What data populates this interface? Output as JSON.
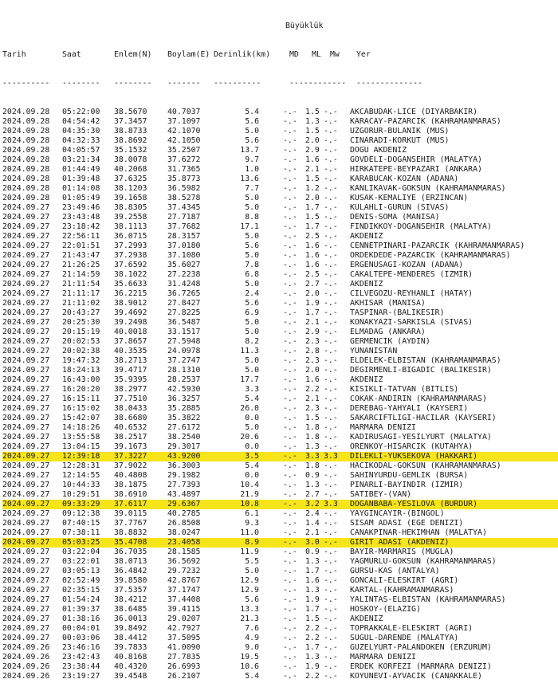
{
  "header": {
    "group_label": "Büyüklük",
    "columns": {
      "date": "Tarih",
      "time": "Saat",
      "lat": "Enlem(N)",
      "lon": "Boylam(E)",
      "depth": "Derinlik(km)",
      "md": "MD",
      "ml": "ML",
      "mw": "Mw",
      "location": "Yer"
    },
    "separators": {
      "date": "----------",
      "time": "--------",
      "lat": "--------",
      "lon": "-------",
      "depth": "----------",
      "mag": "------------",
      "location": "--------------"
    }
  },
  "highlight_color": "#f7e51b",
  "rows": [
    {
      "date": "2024.09.28",
      "time": "05:22:00",
      "lat": "38.5670",
      "lon": "40.7037",
      "depth": "5.4",
      "md": "-.-",
      "ml": "1.5",
      "mw": "-.-",
      "location": "AKCABUDAK-LICE (DIYARBAKIR)",
      "highlight": false
    },
    {
      "date": "2024.09.28",
      "time": "04:54:42",
      "lat": "37.3457",
      "lon": "37.1097",
      "depth": "5.6",
      "md": "-.-",
      "ml": "1.3",
      "mw": "-.-",
      "location": "KARACAY-PAZARCIK (KAHRAMANMARAS)",
      "highlight": false
    },
    {
      "date": "2024.09.28",
      "time": "04:35:30",
      "lat": "38.8733",
      "lon": "42.1070",
      "depth": "5.0",
      "md": "-.-",
      "ml": "1.5",
      "mw": "-.-",
      "location": "UZGORUR-BULANIK (MUS)",
      "highlight": false
    },
    {
      "date": "2024.09.28",
      "time": "04:32:33",
      "lat": "38.8692",
      "lon": "42.1050",
      "depth": "5.6",
      "md": "-.-",
      "ml": "2.0",
      "mw": "-.-",
      "location": "CINARADI-KORKUT (MUS)",
      "highlight": false
    },
    {
      "date": "2024.09.28",
      "time": "04:05:57",
      "lat": "35.1532",
      "lon": "35.2507",
      "depth": "13.7",
      "md": "-.-",
      "ml": "2.9",
      "mw": "-.-",
      "location": "DOGU AKDENIZ",
      "highlight": false
    },
    {
      "date": "2024.09.28",
      "time": "03:21:34",
      "lat": "38.0078",
      "lon": "37.6272",
      "depth": "9.7",
      "md": "-.-",
      "ml": "1.6",
      "mw": "-.-",
      "location": "GOVDELI-DOGANSEHIR (MALATYA)",
      "highlight": false
    },
    {
      "date": "2024.09.28",
      "time": "01:44:49",
      "lat": "40.2068",
      "lon": "31.7365",
      "depth": "1.0",
      "md": "-.-",
      "ml": "2.1",
      "mw": "-.-",
      "location": "HIRKATEPE-BEYPAZARI (ANKARA)",
      "highlight": false
    },
    {
      "date": "2024.09.28",
      "time": "01:39:48",
      "lat": "37.6325",
      "lon": "35.8773",
      "depth": "13.6",
      "md": "-.-",
      "ml": "1.5",
      "mw": "-.-",
      "location": "KARABUCAK-KOZAN (ADANA)",
      "highlight": false
    },
    {
      "date": "2024.09.28",
      "time": "01:14:08",
      "lat": "38.1203",
      "lon": "36.5982",
      "depth": "7.7",
      "md": "-.-",
      "ml": "1.2",
      "mw": "-.-",
      "location": "KANLIKAVAK-GOKSUN (KAHRAMANMARAS)",
      "highlight": false
    },
    {
      "date": "2024.09.28",
      "time": "01:05:49",
      "lat": "39.1658",
      "lon": "38.5278",
      "depth": "5.0",
      "md": "-.-",
      "ml": "2.0",
      "mw": "-.-",
      "location": "KUSAK-KEMALIYE (ERZINCAN)",
      "highlight": false
    },
    {
      "date": "2024.09.27",
      "time": "23:49:46",
      "lat": "38.8305",
      "lon": "37.4345",
      "depth": "5.0",
      "md": "-.-",
      "ml": "1.7",
      "mw": "-.-",
      "location": "KULAHLI-GURUN (SIVAS)",
      "highlight": false
    },
    {
      "date": "2024.09.27",
      "time": "23:43:48",
      "lat": "39.2558",
      "lon": "27.7187",
      "depth": "8.8",
      "md": "-.-",
      "ml": "1.5",
      "mw": "-.-",
      "location": "DENIS-SOMA (MANISA)",
      "highlight": false
    },
    {
      "date": "2024.09.27",
      "time": "23:18:42",
      "lat": "38.1113",
      "lon": "37.7682",
      "depth": "17.1",
      "md": "-.-",
      "ml": "1.7",
      "mw": "-.-",
      "location": "FINDIKKOY-DOGANSEHIR (MALATYA)",
      "highlight": false
    },
    {
      "date": "2024.09.27",
      "time": "22:56:11",
      "lat": "36.0715",
      "lon": "28.3157",
      "depth": "5.0",
      "md": "-.-",
      "ml": "2.5",
      "mw": "-.-",
      "location": "AKDENIZ",
      "highlight": false
    },
    {
      "date": "2024.09.27",
      "time": "22:01:51",
      "lat": "37.2993",
      "lon": "37.0180",
      "depth": "5.6",
      "md": "-.-",
      "ml": "1.6",
      "mw": "-.-",
      "location": "CENNETPINARI-PAZARCIK (KAHRAMANMARAS)",
      "highlight": false
    },
    {
      "date": "2024.09.27",
      "time": "21:43:47",
      "lat": "37.2938",
      "lon": "37.1080",
      "depth": "5.0",
      "md": "-.-",
      "ml": "1.6",
      "mw": "-.-",
      "location": "ORDEKDEDE-PAZARCIK (KAHRAMANMARAS)",
      "highlight": false
    },
    {
      "date": "2024.09.27",
      "time": "21:26:25",
      "lat": "37.6592",
      "lon": "35.6027",
      "depth": "7.8",
      "md": "-.-",
      "ml": "1.6",
      "mw": "-.-",
      "location": "ERGENUSAGI-KOZAN (ADANA)",
      "highlight": false
    },
    {
      "date": "2024.09.27",
      "time": "21:14:59",
      "lat": "38.1022",
      "lon": "27.2238",
      "depth": "6.8",
      "md": "-.-",
      "ml": "2.5",
      "mw": "-.-",
      "location": "CAKALTEPE-MENDERES (IZMIR)",
      "highlight": false
    },
    {
      "date": "2024.09.27",
      "time": "21:11:54",
      "lat": "35.6633",
      "lon": "31.4248",
      "depth": "5.0",
      "md": "-.-",
      "ml": "2.7",
      "mw": "-.-",
      "location": "AKDENIZ",
      "highlight": false
    },
    {
      "date": "2024.09.27",
      "time": "21:11:17",
      "lat": "36.2215",
      "lon": "36.7265",
      "depth": "2.4",
      "md": "-.-",
      "ml": "2.0",
      "mw": "-.-",
      "location": "CILVEGOZU-REYHANLI (HATAY)",
      "highlight": false
    },
    {
      "date": "2024.09.27",
      "time": "21:11:02",
      "lat": "38.9012",
      "lon": "27.8427",
      "depth": "5.6",
      "md": "-.-",
      "ml": "1.9",
      "mw": "-.-",
      "location": "AKHISAR (MANISA)",
      "highlight": false
    },
    {
      "date": "2024.09.27",
      "time": "20:43:27",
      "lat": "39.4692",
      "lon": "27.8225",
      "depth": "6.9",
      "md": "-.-",
      "ml": "1.7",
      "mw": "-.-",
      "location": "TASPINAR-(BALIKESIR)",
      "highlight": false
    },
    {
      "date": "2024.09.27",
      "time": "20:25:30",
      "lat": "39.2498",
      "lon": "36.5487",
      "depth": "5.0",
      "md": "-.-",
      "ml": "2.1",
      "mw": "-.-",
      "location": "KONAKYAZI-SARKISLA (SIVAS)",
      "highlight": false
    },
    {
      "date": "2024.09.27",
      "time": "20:15:19",
      "lat": "40.0018",
      "lon": "33.1517",
      "depth": "5.0",
      "md": "-.-",
      "ml": "2.9",
      "mw": "-.-",
      "location": "ELMADAG (ANKARA)",
      "highlight": false
    },
    {
      "date": "2024.09.27",
      "time": "20:02:53",
      "lat": "37.8657",
      "lon": "27.5948",
      "depth": "8.2",
      "md": "-.-",
      "ml": "2.3",
      "mw": "-.-",
      "location": "GERMENCIK (AYDIN)",
      "highlight": false
    },
    {
      "date": "2024.09.27",
      "time": "20:02:38",
      "lat": "40.3535",
      "lon": "24.0978",
      "depth": "11.3",
      "md": "-.-",
      "ml": "2.8",
      "mw": "-.-",
      "location": "YUNANISTAN",
      "highlight": false
    },
    {
      "date": "2024.09.27",
      "time": "19:47:32",
      "lat": "38.2713",
      "lon": "37.2747",
      "depth": "5.0",
      "md": "-.-",
      "ml": "2.3",
      "mw": "-.-",
      "location": "ELDELEK-ELBISTAN (KAHRAMANMARAS)",
      "highlight": false
    },
    {
      "date": "2024.09.27",
      "time": "18:24:13",
      "lat": "39.4717",
      "lon": "28.1310",
      "depth": "5.0",
      "md": "-.-",
      "ml": "2.0",
      "mw": "-.-",
      "location": "DEGIRMENLI-BIGADIC (BALIKESIR)",
      "highlight": false
    },
    {
      "date": "2024.09.27",
      "time": "16:43:00",
      "lat": "35.9395",
      "lon": "28.2537",
      "depth": "17.7",
      "md": "-.-",
      "ml": "1.6",
      "mw": "-.-",
      "location": "AKDENIZ",
      "highlight": false
    },
    {
      "date": "2024.09.27",
      "time": "16:20:20",
      "lat": "38.2977",
      "lon": "42.5930",
      "depth": "3.3",
      "md": "-.-",
      "ml": "2.2",
      "mw": "-.-",
      "location": "KISIKLI-TATVAN (BITLIS)",
      "highlight": false
    },
    {
      "date": "2024.09.27",
      "time": "16:15:11",
      "lat": "37.7510",
      "lon": "36.3257",
      "depth": "5.4",
      "md": "-.-",
      "ml": "2.1",
      "mw": "-.-",
      "location": "COKAK-ANDIRIN (KAHRAMANMARAS)",
      "highlight": false
    },
    {
      "date": "2024.09.27",
      "time": "16:15:02",
      "lat": "38.0433",
      "lon": "35.2885",
      "depth": "26.0",
      "md": "-.-",
      "ml": "2.3",
      "mw": "-.-",
      "location": "DEREBAG-YAHYALI (KAYSERI)",
      "highlight": false
    },
    {
      "date": "2024.09.27",
      "time": "15:42:07",
      "lat": "38.6680",
      "lon": "35.3822",
      "depth": "0.0",
      "md": "-.-",
      "ml": "1.5",
      "mw": "-.-",
      "location": "SAKARCIFTLIGI-HACILAR (KAYSERI)",
      "highlight": false
    },
    {
      "date": "2024.09.27",
      "time": "14:18:26",
      "lat": "40.6532",
      "lon": "27.6172",
      "depth": "5.0",
      "md": "-.-",
      "ml": "1.8",
      "mw": "-.-",
      "location": "MARMARA DENIZI",
      "highlight": false
    },
    {
      "date": "2024.09.27",
      "time": "13:55:58",
      "lat": "38.2517",
      "lon": "38.2540",
      "depth": "20.6",
      "md": "-.-",
      "ml": "1.8",
      "mw": "-.-",
      "location": "KADIRUSAGI-YESILYURT (MALATYA)",
      "highlight": false
    },
    {
      "date": "2024.09.27",
      "time": "13:04:15",
      "lat": "39.1673",
      "lon": "29.3017",
      "depth": "0.0",
      "md": "-.-",
      "ml": "1.3",
      "mw": "-.-",
      "location": "ORENKOY-HISARCIK (KUTAHYA)",
      "highlight": false
    },
    {
      "date": "2024.09.27",
      "time": "12:39:18",
      "lat": "37.3227",
      "lon": "43.9200",
      "depth": "3.5",
      "md": "-.-",
      "ml": "3.3",
      "mw": "3.3",
      "location": "DILEKLI-YUKSEKOVA (HAKKARI)",
      "highlight": true
    },
    {
      "date": "2024.09.27",
      "time": "12:28:31",
      "lat": "37.9022",
      "lon": "36.3003",
      "depth": "5.4",
      "md": "-.-",
      "ml": "1.8",
      "mw": "-.-",
      "location": "HACIKODAL-GOKSUN (KAHRAMANMARAS)",
      "highlight": false
    },
    {
      "date": "2024.09.27",
      "time": "12:14:55",
      "lat": "40.4808",
      "lon": "29.1982",
      "depth": "0.0",
      "md": "-.-",
      "ml": "0.9",
      "mw": "-.-",
      "location": "SAHINYURDU-GEMLIK (BURSA)",
      "highlight": false
    },
    {
      "date": "2024.09.27",
      "time": "10:44:33",
      "lat": "38.1875",
      "lon": "27.7393",
      "depth": "10.4",
      "md": "-.-",
      "ml": "1.3",
      "mw": "-.-",
      "location": "PINARLI-BAYINDIR (IZMIR)",
      "highlight": false
    },
    {
      "date": "2024.09.27",
      "time": "10:29:51",
      "lat": "38.6910",
      "lon": "43.4897",
      "depth": "21.9",
      "md": "-.-",
      "ml": "2.7",
      "mw": "-.-",
      "location": "SATIBEY-(VAN)",
      "highlight": false
    },
    {
      "date": "2024.09.27",
      "time": "09:33:29",
      "lat": "37.6117",
      "lon": "29.6367",
      "depth": "10.8",
      "md": "-.-",
      "ml": "3.2",
      "mw": "3.3",
      "location": "DOGANBABA-YESILOVA (BURDUR)",
      "highlight": true
    },
    {
      "date": "2024.09.27",
      "time": "09:12:38",
      "lat": "39.0115",
      "lon": "40.2785",
      "depth": "6.1",
      "md": "-.-",
      "ml": "2.4",
      "mw": "-.-",
      "location": "YAYGINCAYIR-(BINGOL)",
      "highlight": false
    },
    {
      "date": "2024.09.27",
      "time": "07:40:15",
      "lat": "37.7767",
      "lon": "26.8508",
      "depth": "9.3",
      "md": "-.-",
      "ml": "1.4",
      "mw": "-.-",
      "location": "SISAM ADASI (EGE DENIZI)",
      "highlight": false
    },
    {
      "date": "2024.09.27",
      "time": "07:38:11",
      "lat": "38.8832",
      "lon": "38.0247",
      "depth": "11.0",
      "md": "-.-",
      "ml": "2.1",
      "mw": "-.-",
      "location": "CANAKPINAR-HEKIMHAN (MALATYA)",
      "highlight": false
    },
    {
      "date": "2024.09.27",
      "time": "05:03:25",
      "lat": "35.4708",
      "lon": "23.4058",
      "depth": "8.9",
      "md": "-.-",
      "ml": "3.0",
      "mw": "-.-",
      "location": "GIRIT ADASI (AKDENIZ)",
      "highlight": true
    },
    {
      "date": "2024.09.27",
      "time": "03:22:04",
      "lat": "36.7035",
      "lon": "28.1585",
      "depth": "11.9",
      "md": "-.-",
      "ml": "0.9",
      "mw": "-.-",
      "location": "BAYIR-MARMARIS (MUGLA)",
      "highlight": false
    },
    {
      "date": "2024.09.27",
      "time": "03:22:01",
      "lat": "38.0713",
      "lon": "36.5692",
      "depth": "5.5",
      "md": "-.-",
      "ml": "1.3",
      "mw": "-.-",
      "location": "YAGMURLU-GOKSUN (KAHRAMANMARAS)",
      "highlight": false
    },
    {
      "date": "2024.09.27",
      "time": "03:05:13",
      "lat": "36.4842",
      "lon": "29.7232",
      "depth": "5.0",
      "md": "-.-",
      "ml": "1.7",
      "mw": "-.-",
      "location": "GURSU-KAS (ANTALYA)",
      "highlight": false
    },
    {
      "date": "2024.09.27",
      "time": "02:52:49",
      "lat": "39.8580",
      "lon": "42.8767",
      "depth": "12.9",
      "md": "-.-",
      "ml": "1.6",
      "mw": "-.-",
      "location": "GONCALI-ELESKIRT (AGRI)",
      "highlight": false
    },
    {
      "date": "2024.09.27",
      "time": "02:35:15",
      "lat": "37.5357",
      "lon": "37.1747",
      "depth": "12.9",
      "md": "-.-",
      "ml": "1.3",
      "mw": "-.-",
      "location": "KARTAL-(KAHRAMANMARAS)",
      "highlight": false
    },
    {
      "date": "2024.09.27",
      "time": "01:54:24",
      "lat": "38.4212",
      "lon": "37.4408",
      "depth": "5.6",
      "md": "-.-",
      "ml": "1.9",
      "mw": "-.-",
      "location": "YALINTAS-ELBISTAN (KAHRAMANMARAS)",
      "highlight": false
    },
    {
      "date": "2024.09.27",
      "time": "01:39:37",
      "lat": "38.6485",
      "lon": "39.4115",
      "depth": "13.3",
      "md": "-.-",
      "ml": "1.7",
      "mw": "-.-",
      "location": "HOSKOY-(ELAZIG)",
      "highlight": false
    },
    {
      "date": "2024.09.27",
      "time": "01:38:16",
      "lat": "36.0013",
      "lon": "29.0207",
      "depth": "21.3",
      "md": "-.-",
      "ml": "1.5",
      "mw": "-.-",
      "location": "AKDENIZ",
      "highlight": false
    },
    {
      "date": "2024.09.27",
      "time": "00:04:01",
      "lat": "39.8492",
      "lon": "42.7927",
      "depth": "7.6",
      "md": "-.-",
      "ml": "2.2",
      "mw": "-.-",
      "location": "TOPRAKKALE-ELESKIRT (AGRI)",
      "highlight": false
    },
    {
      "date": "2024.09.27",
      "time": "00:03:06",
      "lat": "38.4412",
      "lon": "37.5095",
      "depth": "4.9",
      "md": "-.-",
      "ml": "2.2",
      "mw": "-.-",
      "location": "SUGUL-DARENDE (MALATYA)",
      "highlight": false
    },
    {
      "date": "2024.09.26",
      "time": "23:46:16",
      "lat": "39.7833",
      "lon": "41.0090",
      "depth": "9.0",
      "md": "-.-",
      "ml": "1.7",
      "mw": "-.-",
      "location": "GUZELYURT-PALANDOKEN (ERZURUM)",
      "highlight": false
    },
    {
      "date": "2024.09.26",
      "time": "23:42:43",
      "lat": "40.8168",
      "lon": "27.7835",
      "depth": "19.5",
      "md": "-.-",
      "ml": "1.3",
      "mw": "-.-",
      "location": "MARMARA DENIZI",
      "highlight": false
    },
    {
      "date": "2024.09.26",
      "time": "23:38:44",
      "lat": "40.4320",
      "lon": "26.6993",
      "depth": "10.6",
      "md": "-.-",
      "ml": "1.9",
      "mw": "-.-",
      "location": "ERDEK KORFEZI (MARMARA DENIZI)",
      "highlight": false
    },
    {
      "date": "2024.09.26",
      "time": "23:19:27",
      "lat": "39.4548",
      "lon": "26.2107",
      "depth": "5.4",
      "md": "-.-",
      "ml": "2.2",
      "mw": "-.-",
      "location": "KOYUNEVI-AYVACIK (CANAKKALE)",
      "highlight": false
    }
  ]
}
